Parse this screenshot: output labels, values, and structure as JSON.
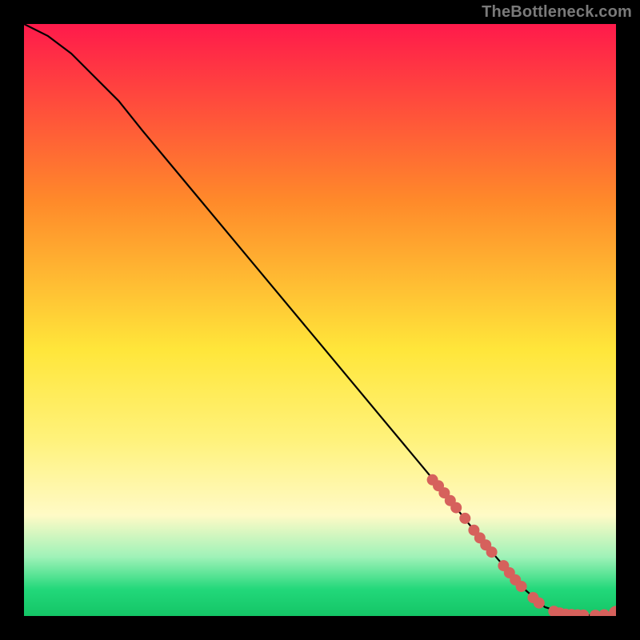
{
  "attribution": "TheBottleneck.com",
  "gradient": {
    "top": "#ff1a4b",
    "orange": "#ff8a2a",
    "yellow": "#ffe63a",
    "yellow_pale": "#fff27a",
    "cream": "#fffac6",
    "mint": "#9ff2b8",
    "green": "#22d87a",
    "bottom_green": "#14c566"
  },
  "gradient_stops": [
    0,
    0.3,
    0.55,
    0.7,
    0.83,
    0.9,
    0.955,
    1.0
  ],
  "curve_color": "#000000",
  "marker_color": "#d6615c",
  "marker_radius_inner": 7,
  "marker_radius_end": 9,
  "chart_data": {
    "type": "line",
    "title": "",
    "xlabel": "",
    "ylabel": "",
    "xlim": [
      0,
      100
    ],
    "ylim": [
      0,
      100
    ],
    "series": [
      {
        "name": "curve",
        "x": [
          0,
          4,
          8,
          12,
          16,
          20,
          30,
          40,
          50,
          60,
          70,
          78,
          84,
          88,
          92,
          96,
          100
        ],
        "y": [
          100,
          98,
          95,
          91,
          87,
          82,
          70,
          58,
          46,
          34,
          22,
          12,
          5,
          1.5,
          0.3,
          0.1,
          0.5
        ]
      }
    ],
    "markers": [
      {
        "x": 69,
        "y": 23.0
      },
      {
        "x": 70,
        "y": 22.0
      },
      {
        "x": 71,
        "y": 20.8
      },
      {
        "x": 72,
        "y": 19.5
      },
      {
        "x": 73,
        "y": 18.3
      },
      {
        "x": 74.5,
        "y": 16.5
      },
      {
        "x": 76,
        "y": 14.5
      },
      {
        "x": 77,
        "y": 13.2
      },
      {
        "x": 78,
        "y": 12.0
      },
      {
        "x": 79,
        "y": 10.8
      },
      {
        "x": 81,
        "y": 8.5
      },
      {
        "x": 82,
        "y": 7.3
      },
      {
        "x": 83,
        "y": 6.1
      },
      {
        "x": 84,
        "y": 5.0
      },
      {
        "x": 86,
        "y": 3.1
      },
      {
        "x": 87,
        "y": 2.2
      },
      {
        "x": 89.5,
        "y": 0.8
      },
      {
        "x": 90.5,
        "y": 0.5
      },
      {
        "x": 91.5,
        "y": 0.3
      },
      {
        "x": 92.5,
        "y": 0.25
      },
      {
        "x": 93.5,
        "y": 0.2
      },
      {
        "x": 94.5,
        "y": 0.15
      },
      {
        "x": 96.5,
        "y": 0.12
      },
      {
        "x": 98,
        "y": 0.2
      }
    ],
    "end_marker": {
      "x": 100,
      "y": 0.5
    }
  }
}
